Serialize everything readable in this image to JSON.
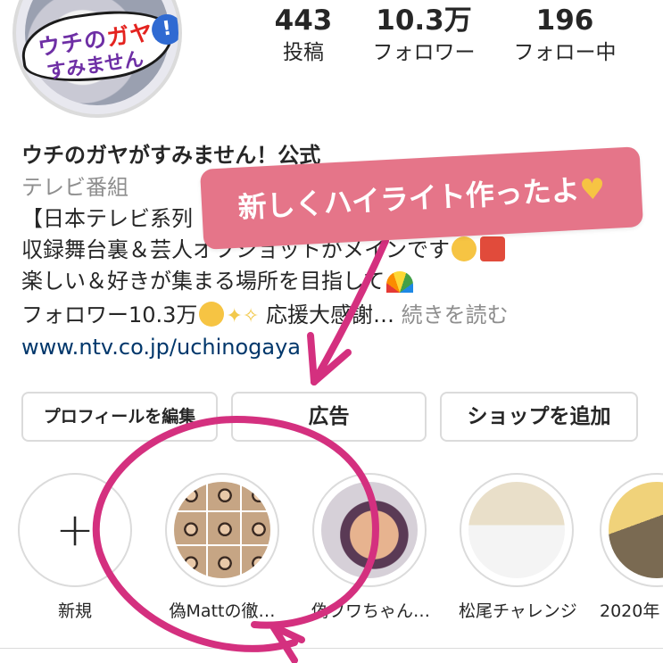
{
  "profile": {
    "avatar_logo_line1_a": "ウチの",
    "avatar_logo_line1_b": "ガヤ",
    "avatar_logo_line1_c": "が",
    "avatar_logo_line2": "すみません",
    "avatar_logo_mark": "!"
  },
  "stats": [
    {
      "value": "443",
      "label": "投稿"
    },
    {
      "value": "10.3万",
      "label": "フォロワー"
    },
    {
      "value": "196",
      "label": "フォロー中"
    }
  ],
  "bio": {
    "name": "ウチのガヤがすみません！公式",
    "category": "テレビ番組",
    "line1": "【日本テレビ系列",
    "line2": "収録舞台裏＆芸人オフショットがメインです",
    "line3": "楽しい＆好きが集まる場所を目指して",
    "line4_a": "フォロワー10.3万",
    "line4_b": "応援大感謝…",
    "line4_more": "続きを読む",
    "link": "www.ntv.co.jp/uchinogaya"
  },
  "buttons": {
    "edit_profile": "プロフィールを編集",
    "ad": "広告",
    "add_shop": "ショップを追加"
  },
  "highlights": [
    {
      "label": "新規",
      "icon": "plus-icon"
    },
    {
      "label": "偽Mattの徹…"
    },
    {
      "label": "偽フワちゃん…"
    },
    {
      "label": "松尾チャレンジ"
    },
    {
      "label": "2020年"
    }
  ],
  "annotation": {
    "callout_text": "新しくハイライト作ったよ",
    "callout_color": "#e57589",
    "stroke_color": "#d4307f"
  }
}
